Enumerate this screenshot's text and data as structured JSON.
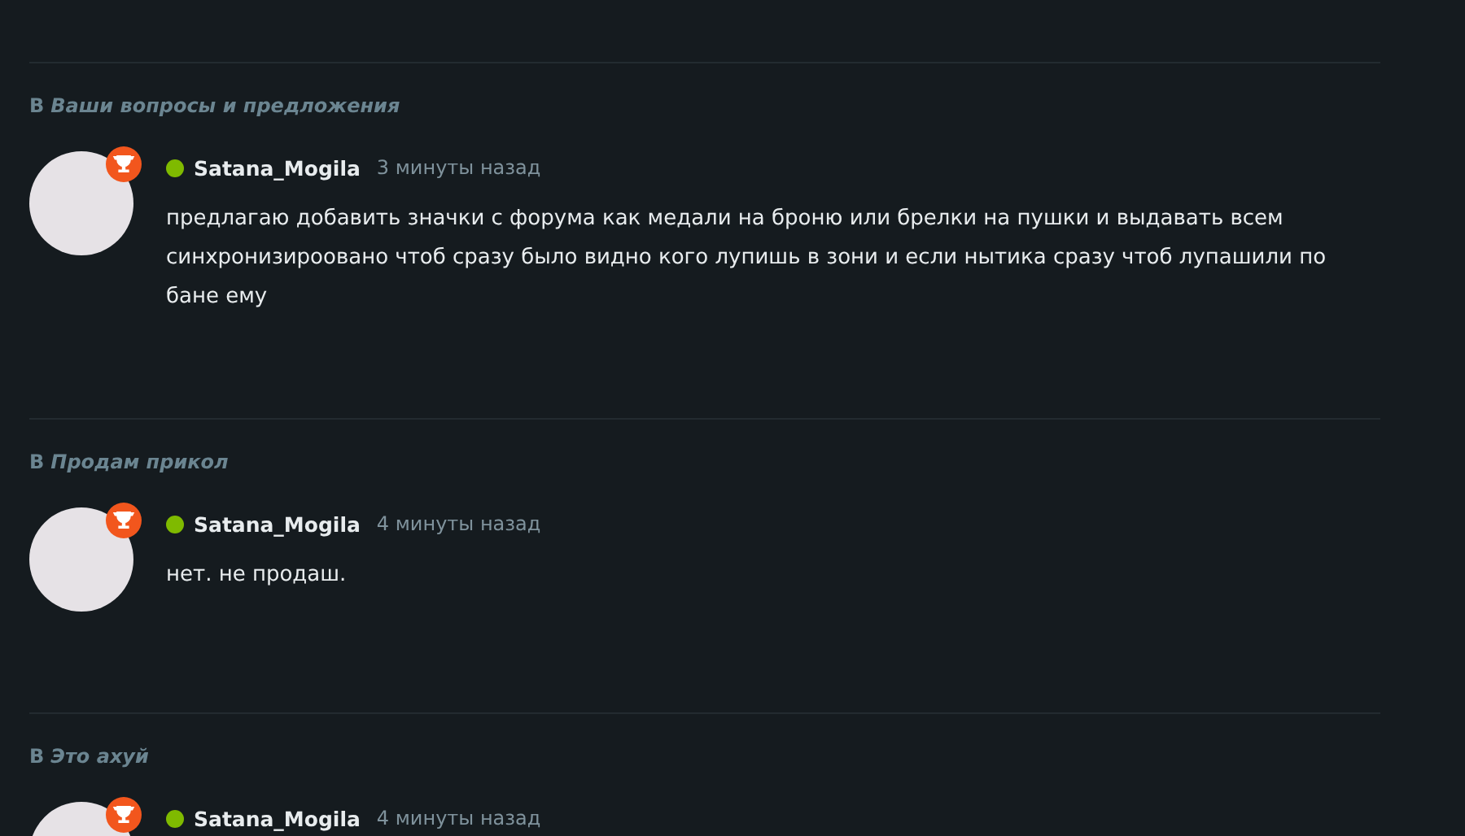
{
  "activity": [
    {
      "prefix": "В",
      "thread": "Ваши вопросы и предложения",
      "author": "Satana_Mogila",
      "online": true,
      "time": "3 минуты назад",
      "text": "предлагаю добавить значки с форума как медали на броню или брелки на пушки и выдавать всем синхронизироовано чтоб сразу было видно кого лупишь в зони и если нытика сразу чтоб лупашили по бане ему"
    },
    {
      "prefix": "В",
      "thread": "Продам прикол",
      "author": "Satana_Mogila",
      "online": true,
      "time": "4 минуты назад",
      "text": "нет. не продаш."
    },
    {
      "prefix": "В",
      "thread": "Это ахуй",
      "author": "Satana_Mogila",
      "online": true,
      "time": "4 минуты назад"
    }
  ]
}
